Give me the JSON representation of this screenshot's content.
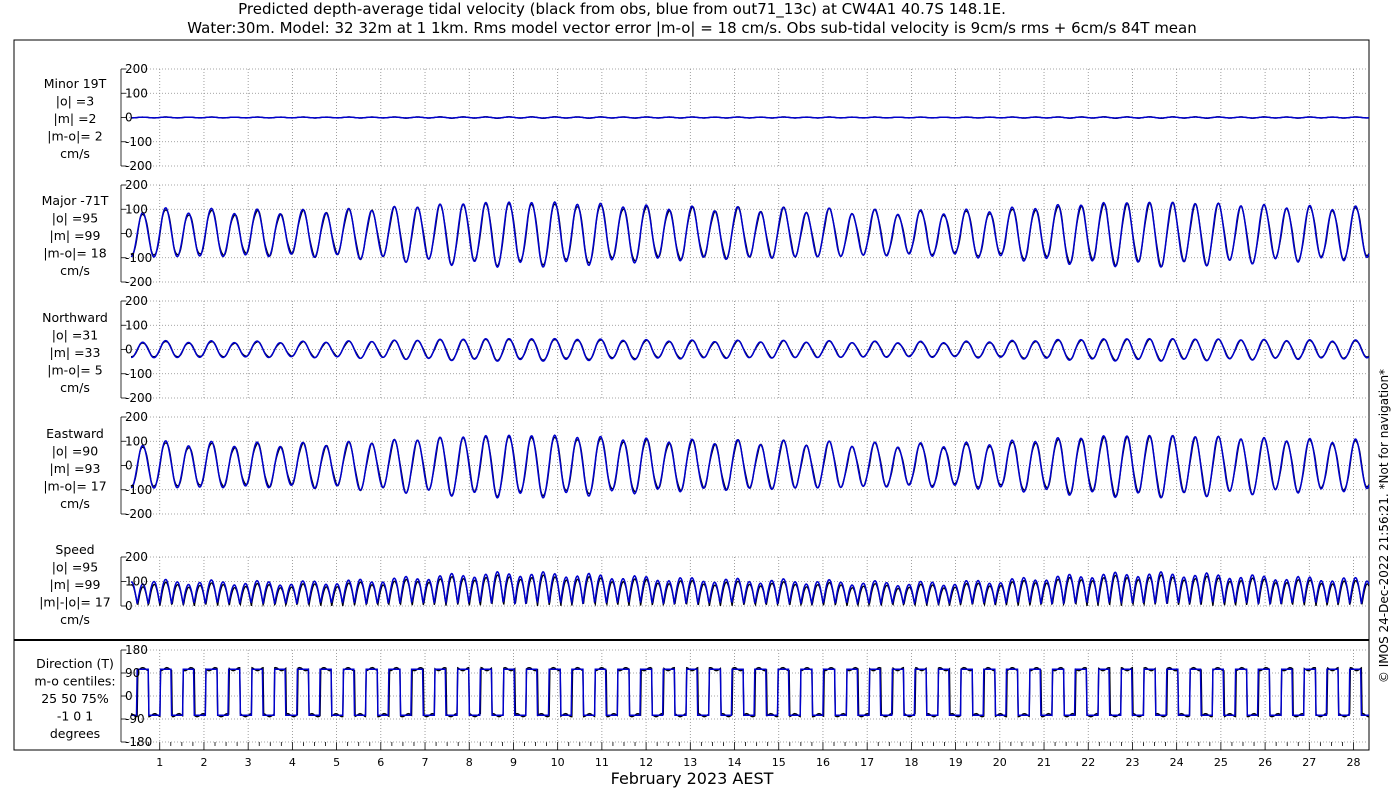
{
  "title_line1": "Predicted depth-average tidal velocity (black from obs, blue from out71_13c) at CW4A1 40.7S 148.1E.",
  "title_line2": "Water:30m. Model: 32 32m at 1 1km. Rms model vector error |m-o| = 18 cm/s. Obs sub-tidal velocity is 9cm/s rms + 6cm/s 84T mean",
  "footer": "© IMOS 24-Dec-2022 21:56:21. *Not for navigation*",
  "colors": {
    "obs": "#000000",
    "model": "#0000cc",
    "grid": "#888888"
  },
  "chart_data": {
    "xlabel": "February 2023 AEST",
    "x_ticks": [
      "1",
      "2",
      "3",
      "4",
      "5",
      "6",
      "7",
      "8",
      "9",
      "10",
      "11",
      "12",
      "13",
      "14",
      "15",
      "16",
      "17",
      "18",
      "19",
      "20",
      "21",
      "22",
      "23",
      "24",
      "25",
      "26",
      "27",
      "28"
    ],
    "xlim_days": [
      0.35,
      28.35
    ],
    "panels": [
      {
        "type": "line",
        "kind": "velocity",
        "labels": [
          "Minor 19T",
          "|o| =3",
          "|m| =2",
          "|m-o|= 2",
          "cm/s"
        ],
        "ylim": [
          -200,
          200
        ],
        "yticks": [
          "200",
          "100",
          "0",
          "-100",
          "-200"
        ],
        "ytick_values": [
          200,
          100,
          0,
          -100,
          -200
        ],
        "amplitude_cm_s": {
          "obs": 3,
          "model": 2
        }
      },
      {
        "type": "line",
        "kind": "velocity",
        "labels": [
          "Major -71T",
          "|o| =95",
          "|m| =99",
          "|m-o|= 18",
          "cm/s"
        ],
        "ylim": [
          -200,
          200
        ],
        "yticks": [
          "200",
          "100",
          "0",
          "-100",
          "-200"
        ],
        "ytick_values": [
          200,
          100,
          0,
          -100,
          -200
        ],
        "amplitude_cm_s": {
          "obs": 125,
          "model": 130
        }
      },
      {
        "type": "line",
        "kind": "velocity",
        "labels": [
          "Northward",
          "|o| =31",
          "|m| =33",
          "|m-o|= 5",
          "cm/s"
        ],
        "ylim": [
          -200,
          200
        ],
        "yticks": [
          "200",
          "100",
          "0",
          "-100",
          "-200"
        ],
        "ytick_values": [
          200,
          100,
          0,
          -100,
          -200
        ],
        "amplitude_cm_s": {
          "obs": 42,
          "model": 45
        }
      },
      {
        "type": "line",
        "kind": "velocity",
        "labels": [
          "Eastward",
          "|o| =90",
          "|m| =93",
          "|m-o|= 17",
          "cm/s"
        ],
        "ylim": [
          -200,
          200
        ],
        "yticks": [
          "200",
          "100",
          "0",
          "-100",
          "-200"
        ],
        "ytick_values": [
          200,
          100,
          0,
          -100,
          -200
        ],
        "amplitude_cm_s": {
          "obs": 120,
          "model": 125
        }
      },
      {
        "type": "line",
        "kind": "speed",
        "labels": [
          "Speed",
          "|o| =95",
          "|m| =99",
          "|m|-|o|= 17",
          "cm/s"
        ],
        "ylim": [
          0,
          200
        ],
        "yticks": [
          "200",
          "100",
          "0"
        ],
        "ytick_values": [
          200,
          100,
          0
        ],
        "amplitude_cm_s": {
          "obs": 125,
          "model": 130
        }
      },
      {
        "type": "line",
        "kind": "direction",
        "labels": [
          "Direction (T)",
          "m-o centiles:",
          "25  50  75%",
          "-1 0 1",
          "degrees"
        ],
        "ylim": [
          -180,
          180
        ],
        "yticks": [
          "180",
          "90",
          "0",
          "-90",
          "-180"
        ],
        "ytick_values": [
          180,
          90,
          0,
          -90,
          -180
        ],
        "levels_deg": {
          "flood": 105,
          "ebb": -75
        }
      }
    ]
  }
}
